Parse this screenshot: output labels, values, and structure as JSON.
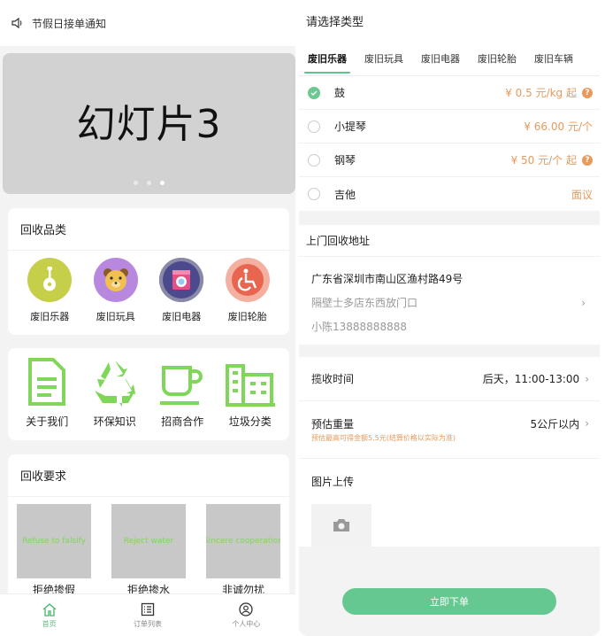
{
  "left": {
    "notice": "节假日接单通知",
    "banner": {
      "text": "幻灯片3",
      "slides": 3,
      "active_slide": 3
    },
    "categories": {
      "title": "回收品类",
      "items": [
        {
          "label": "废旧乐器",
          "icon": "guitar-icon",
          "color": "#c5cf4a"
        },
        {
          "label": "废旧玩具",
          "icon": "bear-icon",
          "color": "#b888de"
        },
        {
          "label": "废旧电器",
          "icon": "washer-icon",
          "color": "#4a4a8c"
        },
        {
          "label": "废旧轮胎",
          "icon": "wheelchair-icon",
          "color": "#e86650"
        }
      ]
    },
    "features": [
      {
        "label": "关于我们",
        "icon": "document-icon"
      },
      {
        "label": "环保知识",
        "icon": "recycle-icon"
      },
      {
        "label": "招商合作",
        "icon": "cup-icon"
      },
      {
        "label": "垃圾分类",
        "icon": "building-icon"
      }
    ],
    "requirements": {
      "title": "回收要求",
      "items": [
        {
          "img_text": "Refuse to falsify",
          "label": "拒绝掺假"
        },
        {
          "img_text": "Reject water",
          "label": "拒绝掺水"
        },
        {
          "img_text": "Sincere cooperation",
          "label": "非诚勿扰"
        }
      ]
    },
    "tabbar": [
      {
        "label": "首页",
        "icon": "home-icon",
        "active": true
      },
      {
        "label": "订单列表",
        "icon": "list-icon",
        "active": false
      },
      {
        "label": "个人中心",
        "icon": "user-icon",
        "active": false
      }
    ],
    "accent": "#7fd65a"
  },
  "right": {
    "header": "请选择类型",
    "tabs": [
      "废旧乐器",
      "废旧玩具",
      "废旧电器",
      "废旧轮胎",
      "废旧车辆"
    ],
    "options": [
      {
        "name": "鼓",
        "price": "¥ 0.5 元/kg 起",
        "help": true,
        "checked": true
      },
      {
        "name": "小提琴",
        "price": "¥ 66.00 元/个",
        "help": false,
        "checked": false
      },
      {
        "name": "钢琴",
        "price": "¥ 50 元/个 起",
        "help": true,
        "checked": false
      },
      {
        "name": "吉他",
        "price": "面议",
        "help": false,
        "checked": false
      }
    ],
    "address": {
      "title": "上门回收地址",
      "line1": "广东省深圳市南山区渔村路49号",
      "line2": "隔壁士多店东西放门口",
      "contact": "小陈13888888888"
    },
    "pickup_time": {
      "label": "揽收时间",
      "value": "后天，11:00-13:00"
    },
    "weight": {
      "label": "预估重量",
      "value": "5公斤以内",
      "tip": "预估最高可得金额5.5元(结算价格以实际为准)"
    },
    "upload": {
      "title": "图片上传"
    },
    "submit_label": "立即下单",
    "accent": "#66c891",
    "price_color": "#e69a5c"
  }
}
